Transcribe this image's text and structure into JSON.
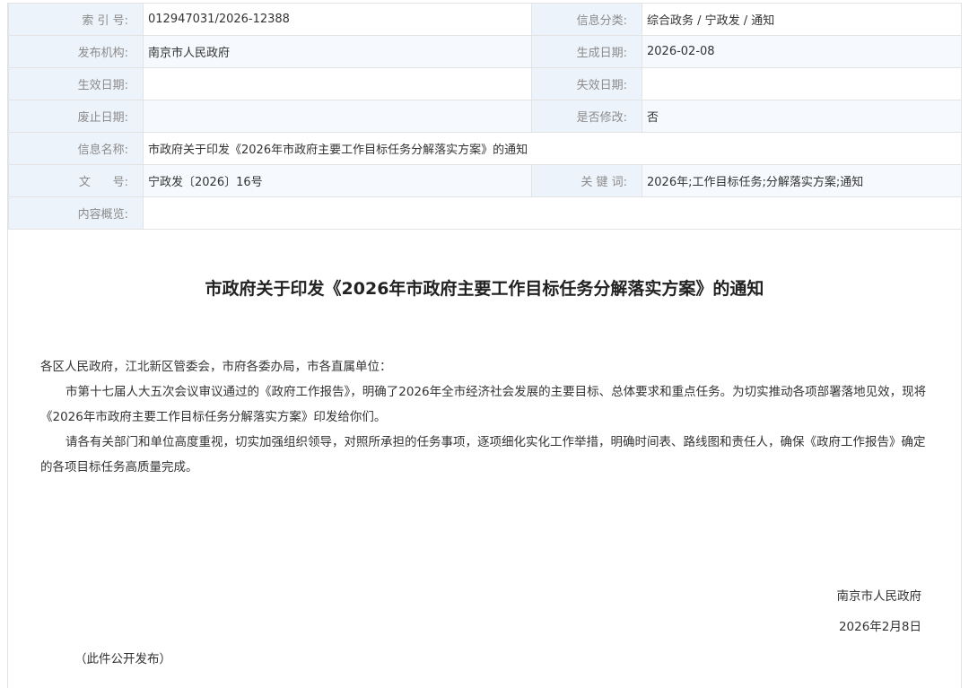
{
  "meta": {
    "index_label": "索 引 号:",
    "index_value": "012947031/2026-12388",
    "category_label": "信息分类:",
    "category_value": "综合政务 / 宁政发 / 通知",
    "issuer_label": "发布机构:",
    "issuer_value": "南京市人民政府",
    "created_label": "生成日期:",
    "created_value": "2026-02-08",
    "effective_label": "生效日期:",
    "effective_value": "",
    "expiry_label": "失效日期:",
    "expiry_value": "",
    "repeal_label": "废止日期:",
    "repeal_value": "",
    "modified_label": "是否修改:",
    "modified_value": "否",
    "name_label": "信息名称:",
    "name_value": "市政府关于印发《2026年市政府主要工作目标任务分解落实方案》的通知",
    "docno_label": "文      号:",
    "docno_value": "宁政发〔2026〕16号",
    "keywords_label": "关 键 词:",
    "keywords_value": "2026年;工作目标任务;分解落实方案;通知",
    "summary_label": "内容概览:",
    "summary_value": ""
  },
  "document": {
    "title": "市政府关于印发《2026年市政府主要工作目标任务分解落实方案》的通知",
    "salutation": "各区人民政府，江北新区管委会，市府各委办局，市各直属单位：",
    "paragraph1": "市第十七届人大五次会议审议通过的《政府工作报告》，明确了2026年全市经济社会发展的主要目标、总体要求和重点任务。为切实推动各项部署落地见效，现将《2026年市政府主要工作目标任务分解落实方案》印发给你们。",
    "paragraph2": "请各有关部门和单位高度重视，切实加强组织领导，对照所承担的任务事项，逐项细化实化工作举措，明确时间表、路线图和责任人，确保《政府工作报告》确定的各项目标任务高质量完成。",
    "signature": "南京市人民政府",
    "date": "2026年2月8日",
    "note": "（此件公开发布）"
  }
}
